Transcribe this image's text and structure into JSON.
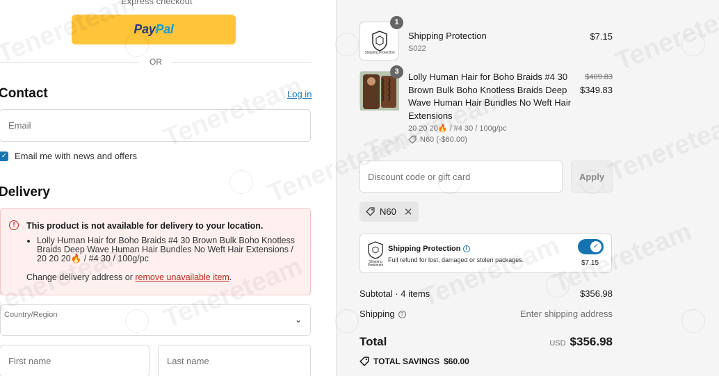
{
  "express_checkout": {
    "label": "Express checkout"
  },
  "paypal": {
    "label_pay": "Pay",
    "label_pal": "Pal"
  },
  "divider": {
    "or": "OR"
  },
  "contact": {
    "heading": "Contact",
    "login_link": "Log in",
    "email_placeholder": "Email",
    "newsletter_label": "Email me with news and offers",
    "newsletter_checked": true
  },
  "delivery": {
    "heading": "Delivery",
    "alert_title": "This product is not available for delivery to your location.",
    "alert_item": "Lolly Human Hair for Boho Braids #4 30 Brown Bulk Boho Knotless Braids Deep Wave Human Hair Bundles No Weft Hair Extensions / 20 20 20🔥 / #4 30 / 100g/pc",
    "alert_change_text": "Change delivery address or ",
    "alert_remove_link": "remove unavailable item",
    "alert_end": ".",
    "country_label": "Country/Region",
    "first_name_placeholder": "First name",
    "last_name_placeholder": "Last name"
  },
  "cart": {
    "items": [
      {
        "name": "Shipping Protection",
        "sku": "S022",
        "qty": "1",
        "price": "$7.15",
        "thumb_caption": "Shipping Protection"
      },
      {
        "name": "Lolly Human Hair for Boho Braids #4 30 Brown Bulk Boho Knotless Braids Deep Wave Human Hair Bundles No Weft Hair Extensions",
        "variant": "20 20 20🔥 / #4 30 / 100g/pc",
        "discount": "N60 (-$60.00)",
        "qty": "3",
        "original_price": "$409.83",
        "price": "$349.83"
      }
    ],
    "discount_placeholder": "Discount code or gift card",
    "apply_label": "Apply",
    "applied_code": "N60",
    "protection": {
      "title": "Shipping Protection",
      "description": "Full refund for lost, damaged or stolen packages.",
      "price": "$7.15",
      "enabled": true,
      "logo_caption": "Shipping Protection"
    },
    "subtotal_label": "Subtotal · 4 items",
    "subtotal_value": "$356.98",
    "shipping_label": "Shipping",
    "shipping_value": "Enter shipping address",
    "total_label": "Total",
    "currency": "USD",
    "total_value": "$356.98",
    "savings_label": "TOTAL SAVINGS",
    "savings_value": "$60.00"
  },
  "watermark": {
    "text": "Tenereteam"
  },
  "colors": {
    "accent": "#1773b0",
    "paypal_yellow": "#ffc439",
    "alert_bg": "#fff0f0",
    "error": "#c0291c"
  }
}
